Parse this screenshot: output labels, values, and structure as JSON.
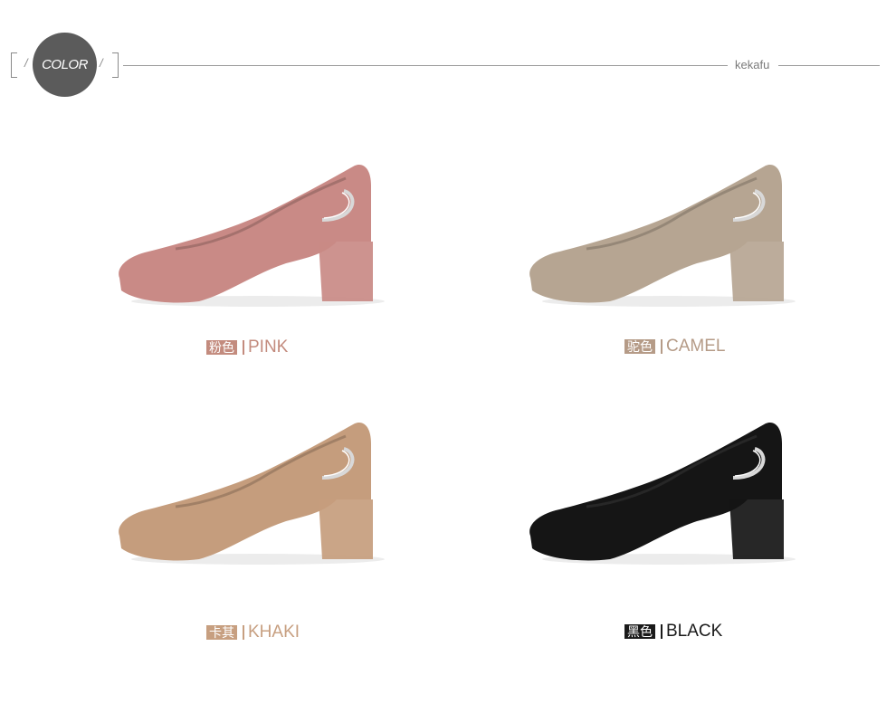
{
  "header": {
    "badge_label": "COLOR",
    "bracket_slash": "/",
    "brand": "kekafu"
  },
  "products": [
    {
      "name_cn": "粉色",
      "name_en": "PINK",
      "label_color": "#c38b7e",
      "shoe_color": "#c98a86"
    },
    {
      "name_cn": "驼色",
      "name_en": "CAMEL",
      "label_color": "#b59b87",
      "shoe_color": "#b6a592"
    },
    {
      "name_cn": "卡其",
      "name_en": "KHAKI",
      "label_color": "#c79f80",
      "shoe_color": "#c59d7d"
    },
    {
      "name_cn": "黑色",
      "name_en": "BLACK",
      "label_color": "#1a1a1a",
      "shoe_color": "#151515"
    }
  ],
  "icons": {
    "shoe": "pump-shoe-icon",
    "buckle": "crescent-buckle-icon"
  }
}
